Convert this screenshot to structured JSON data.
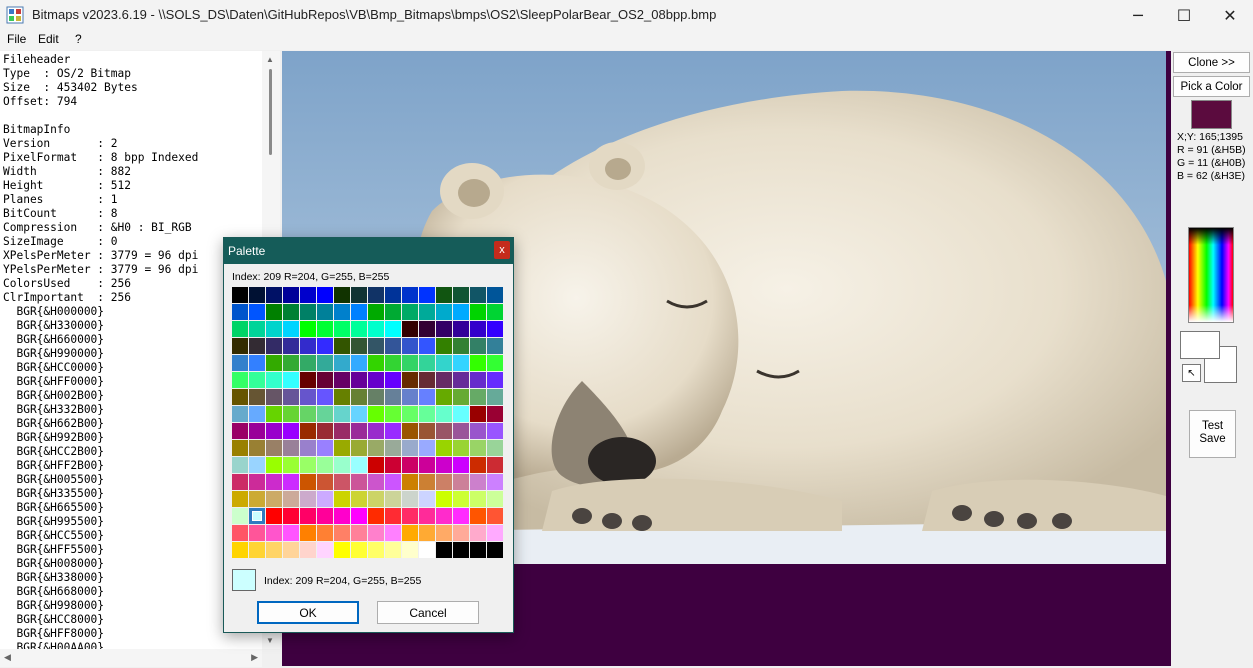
{
  "window": {
    "title": "Bitmaps v2023.6.19 - \\\\SOLS_DS\\Daten\\GitHubRepos\\VB\\Bmp_Bitmaps\\bmps\\OS2\\SleepPolarBear_OS2_08bpp.bmp",
    "minimize": "─",
    "maximize": "☐",
    "close": "✕"
  },
  "menu": {
    "file": "File",
    "edit": "Edit",
    "help": "?"
  },
  "info_text": "Fileheader\nType  : OS/2 Bitmap\nSize  : 453402 Bytes\nOffset: 794\n\nBitmapInfo\nVersion       : 2\nPixelFormat   : 8 bpp Indexed\nWidth         : 882\nHeight        : 512\nPlanes        : 1\nBitCount      : 8\nCompression   : &H0 : BI_RGB\nSizeImage     : 0\nXPelsPerMeter : 3779 = 96 dpi\nYPelsPerMeter : 3779 = 96 dpi\nColorsUsed    : 256\nClrImportant  : 256\n  BGR{&H000000}\n  BGR{&H330000}\n  BGR{&H660000}\n  BGR{&H990000}\n  BGR{&HCC0000}\n  BGR{&HFF0000}\n  BGR{&H002B00}\n  BGR{&H332B00}\n  BGR{&H662B00}\n  BGR{&H992B00}\n  BGR{&HCC2B00}\n  BGR{&HFF2B00}\n  BGR{&H005500}\n  BGR{&H335500}\n  BGR{&H665500}\n  BGR{&H995500}\n  BGR{&HCC5500}\n  BGR{&HFF5500}\n  BGR{&H008000}\n  BGR{&H338000}\n  BGR{&H668000}\n  BGR{&H998000}\n  BGR{&HCC8000}\n  BGR{&HFF8000}\n  BGR{&H00AA00}",
  "right_panel": {
    "clone_label": "Clone >>",
    "pick_label": "Pick a Color",
    "picked_color": "#5b0b3e",
    "xy": "X;Y: 165;1395",
    "r": "R = 91 (&H5B)",
    "g": "G = 11 (&H0B)",
    "b": "B = 62 (&H3E)",
    "swap_icon": "↖",
    "test_save_label": "Test\nSave"
  },
  "palette_dialog": {
    "title": "Palette",
    "close": "x",
    "index_top": "Index: 209 R=204, G=255, B=255",
    "index_bottom": "Index: 209 R=204, G=255, B=255",
    "selected_index": 209,
    "selected_color": "#ccffff",
    "ok_label": "OK",
    "cancel_label": "Cancel",
    "colors": [
      "#000000",
      "#001133",
      "#001166",
      "#000099",
      "#0000cc",
      "#0000ff",
      "#113300",
      "#113333",
      "#113366",
      "#003399",
      "#0033cc",
      "#0033ff",
      "#115511",
      "#115533",
      "#115566",
      "#005599",
      "#0055cc",
      "#0055ff",
      "#008000",
      "#008033",
      "#008066",
      "#008099",
      "#0080cc",
      "#0080ff",
      "#00aa00",
      "#00aa33",
      "#00aa66",
      "#00aa99",
      "#00aacc",
      "#00aaff",
      "#00d400",
      "#00d433",
      "#00d466",
      "#00d499",
      "#00d4cc",
      "#00d4ff",
      "#00ff00",
      "#00ff33",
      "#00ff66",
      "#00ff99",
      "#00ffcc",
      "#00ffff",
      "#330000",
      "#330033",
      "#330066",
      "#330099",
      "#3300cc",
      "#3300ff",
      "#332b00",
      "#332b33",
      "#332b66",
      "#332b99",
      "#332bcc",
      "#332bff",
      "#335500",
      "#335533",
      "#335566",
      "#335599",
      "#3355cc",
      "#3355ff",
      "#338000",
      "#338033",
      "#338066",
      "#338099",
      "#3380cc",
      "#3380ff",
      "#33aa00",
      "#33aa33",
      "#33aa66",
      "#33aa99",
      "#33aacc",
      "#33aaff",
      "#33d400",
      "#33d433",
      "#33d466",
      "#33d499",
      "#33d4cc",
      "#33d4ff",
      "#33ff00",
      "#33ff33",
      "#33ff66",
      "#33ff99",
      "#33ffcc",
      "#33ffff",
      "#660000",
      "#660033",
      "#660066",
      "#660099",
      "#6600cc",
      "#6600ff",
      "#662b00",
      "#662b33",
      "#662b66",
      "#662b99",
      "#662bcc",
      "#662bff",
      "#665500",
      "#665533",
      "#665566",
      "#665599",
      "#6655cc",
      "#6655ff",
      "#668000",
      "#668033",
      "#668066",
      "#668099",
      "#6680cc",
      "#6680ff",
      "#66aa00",
      "#66aa33",
      "#66aa66",
      "#66aa99",
      "#66aacc",
      "#66aaff",
      "#66d400",
      "#66d433",
      "#66d466",
      "#66d499",
      "#66d4cc",
      "#66d4ff",
      "#66ff00",
      "#66ff33",
      "#66ff66",
      "#66ff99",
      "#66ffcc",
      "#66ffff",
      "#990000",
      "#990033",
      "#990066",
      "#990099",
      "#9900cc",
      "#9900ff",
      "#992b00",
      "#992b33",
      "#992b66",
      "#992b99",
      "#992bcc",
      "#992bff",
      "#995500",
      "#995533",
      "#995566",
      "#995599",
      "#9955cc",
      "#9955ff",
      "#998000",
      "#998033",
      "#998066",
      "#998099",
      "#9980cc",
      "#9980ff",
      "#99aa00",
      "#99aa33",
      "#99aa66",
      "#99aa99",
      "#99aacc",
      "#99aaff",
      "#99d400",
      "#99d433",
      "#99d466",
      "#99d499",
      "#99d4cc",
      "#99d4ff",
      "#99ff00",
      "#99ff33",
      "#99ff66",
      "#99ff99",
      "#99ffcc",
      "#99ffff",
      "#cc0000",
      "#cc0033",
      "#cc0066",
      "#cc0099",
      "#cc00cc",
      "#cc00ff",
      "#cc2b00",
      "#cc2b33",
      "#cc2b66",
      "#cc2b99",
      "#cc2bcc",
      "#cc2bff",
      "#cc5500",
      "#cc5533",
      "#cc5566",
      "#cc5599",
      "#cc55cc",
      "#cc55ff",
      "#cc8000",
      "#cc8033",
      "#cc8066",
      "#cc8099",
      "#cc80cc",
      "#cc80ff",
      "#ccaa00",
      "#ccaa33",
      "#ccaa66",
      "#ccaa99",
      "#ccaacc",
      "#ccaaff",
      "#ccd400",
      "#ccd433",
      "#ccd466",
      "#ccd499",
      "#ccd4cc",
      "#ccd4ff",
      "#ccff00",
      "#ccff33",
      "#ccff66",
      "#ccff99",
      "#ccffcc",
      "#ccffff",
      "#ff0000",
      "#ff0033",
      "#ff0066",
      "#ff0099",
      "#ff00cc",
      "#ff00ff",
      "#ff2b00",
      "#ff2b33",
      "#ff2b66",
      "#ff2b99",
      "#ff2bcc",
      "#ff2bff",
      "#ff5500",
      "#ff5533",
      "#ff5566",
      "#ff5599",
      "#ff55cc",
      "#ff55ff",
      "#ff8000",
      "#ff8033",
      "#ff8066",
      "#ff8099",
      "#ff80cc",
      "#ff80ff",
      "#ffaa00",
      "#ffaa33",
      "#ffaa66",
      "#ffaa99",
      "#ffaacc",
      "#ffaaff",
      "#ffd400",
      "#ffd433",
      "#ffd466",
      "#ffd499",
      "#ffd4cc",
      "#ffd4ff",
      "#ffff00",
      "#ffff33",
      "#ffff66",
      "#ffff99",
      "#ffffcc",
      "#ffffff",
      "#000000",
      "#000000",
      "#000000",
      "#000000"
    ]
  },
  "colors": {
    "image_background": "#3e0040",
    "dialog_title_bar": "#155c59",
    "selection_outline": "#2f7bc0"
  }
}
